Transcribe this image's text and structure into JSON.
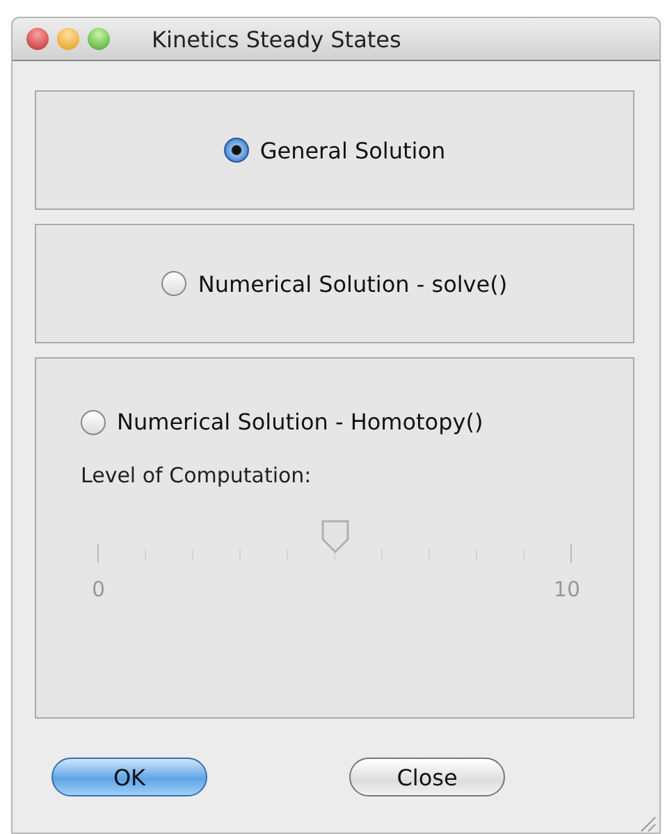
{
  "window": {
    "title": "Kinetics Steady States"
  },
  "options": [
    {
      "label": "General Solution",
      "selected": true
    },
    {
      "label": "Numerical Solution - solve()",
      "selected": false
    },
    {
      "label": "Numerical Solution - Homotopy()",
      "selected": false
    }
  ],
  "slider": {
    "label": "Level of Computation:",
    "level": 0.5,
    "disabled": true,
    "min_label": "0",
    "max_label": "10"
  },
  "buttons": [
    {
      "label": "OK",
      "default": true
    },
    {
      "label": "Close",
      "default": false
    }
  ]
}
